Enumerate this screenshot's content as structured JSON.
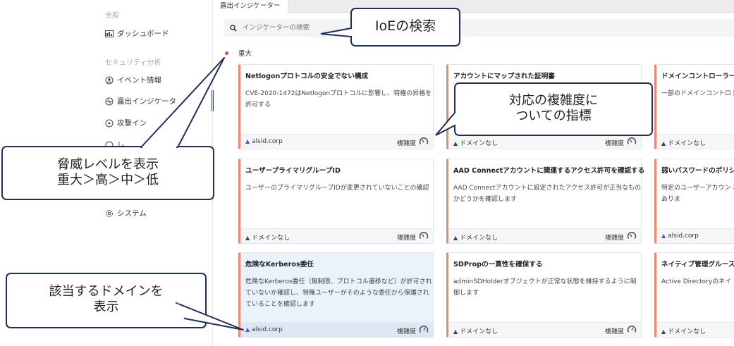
{
  "sidebar": {
    "section_general": "全般",
    "dashboard": "ダッシュボード",
    "section_security": "セキュリティ分析",
    "events": "イベント情報",
    "ioe": "露出インジケータ",
    "attack": "攻撃イン",
    "fourth": "レ",
    "system": "システム"
  },
  "topbar": {
    "tab": "露出インジケーター"
  },
  "search": {
    "placeholder": "インジケーターの検索"
  },
  "severity": {
    "label": "重大"
  },
  "cards": [
    {
      "title": "Netlogonプロトコルの安全でない構成",
      "desc": "CVE-2020-1472はNetlogonプロトコルに影響し、特権の昇格を許可する",
      "domain": "alsid.corp",
      "complexity": "複雑度",
      "highlight": false
    },
    {
      "title": "アカウントにマップされた証明書",
      "desc": "",
      "domain": "ドメインなし",
      "complexity": "複雑度",
      "highlight": false
    },
    {
      "title": "ドメインコントローラー",
      "desc": "一部のドメインコントロ 因で非管理ユーザーによ",
      "domain": "ドメインなし",
      "complexity": "",
      "highlight": false
    },
    {
      "title": "ユーザープライマリグループID",
      "desc": "ユーザーのプライマリグループIDが変更されていないことの確認",
      "domain": "ドメインなし",
      "complexity": "複雑度",
      "highlight": false
    },
    {
      "title": "AAD Connectアカウントに関連するアクセス許可を確認する",
      "desc": "AAD Connectアカウントに設定されたアクセス許可が正当なものかどうかを確認します",
      "domain": "ドメインなし",
      "complexity": "複雑度",
      "highlight": false
    },
    {
      "title": "弱いパスワードのポリシ",
      "desc": "特定のユーザーアカウン ポリシーは、十分に強 つながる可能性がありま",
      "domain": "alsid.corp",
      "complexity": "",
      "highlight": false
    },
    {
      "title": "危険なKerberos委任",
      "desc": "危険なKerberos委任（無制限、プロトコル遷移など）が許可されていないか確認し、特権ユーザーがそのような委任から保護されていることを確認します",
      "domain": "alsid.corp",
      "complexity": "複雑度",
      "highlight": true
    },
    {
      "title": "SDPropの一貫性を確保する",
      "desc": "adminSDHolderオブジェクトが正常な状態を維持するように制御します",
      "domain": "ドメインなし",
      "complexity": "複雑度",
      "highlight": false
    },
    {
      "title": "ネイティブ管理グルース",
      "desc": "Active Directoryのネイ ト",
      "domain": "ドメインなし",
      "complexity": "",
      "highlight": false
    }
  ],
  "callouts": {
    "search": "IoEの検索",
    "complexity_line1": "対応の複雑度に",
    "complexity_line2": "ついての指標",
    "threat_line1": "脅威レベルを表示",
    "threat_line2": "重大＞高＞中＞低",
    "domain_line1": "該当するドメインを",
    "domain_line2": "表示"
  }
}
